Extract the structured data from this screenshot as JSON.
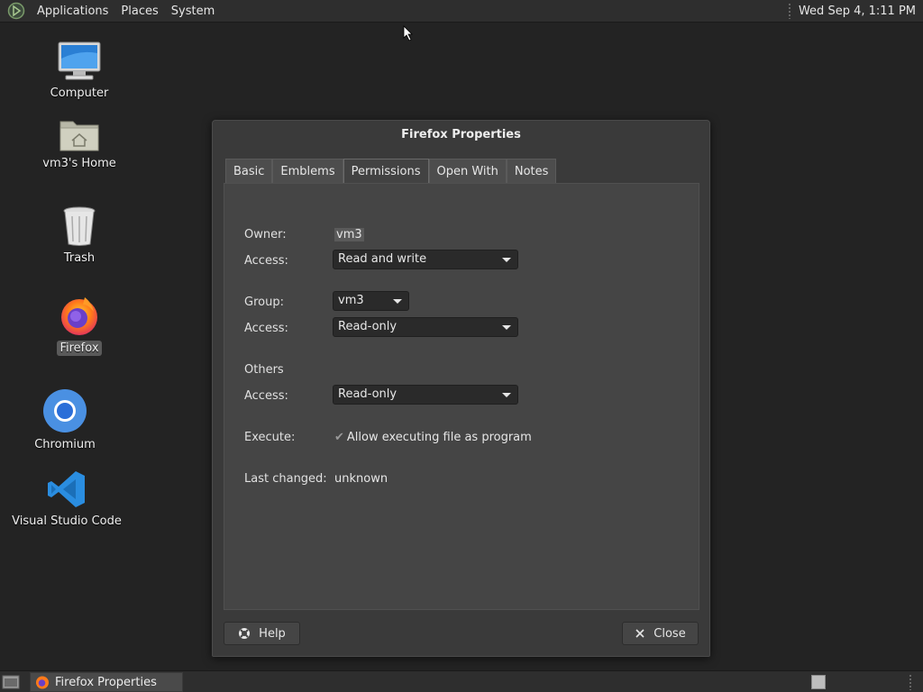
{
  "top_panel": {
    "menus": [
      "Applications",
      "Places",
      "System"
    ],
    "clock": "Wed Sep  4, 1:11 PM"
  },
  "desktop_icons": [
    {
      "label": "Computer",
      "icon": "computer-icon"
    },
    {
      "label": "vm3's Home",
      "icon": "home-folder-icon"
    },
    {
      "label": "Trash",
      "icon": "trash-icon"
    },
    {
      "label": "Firefox",
      "icon": "firefox-icon",
      "selected": true
    },
    {
      "label": "Chromium",
      "icon": "chromium-icon"
    },
    {
      "label": "Visual Studio Code",
      "icon": "vscode-icon"
    }
  ],
  "dialog": {
    "title": "Firefox Properties",
    "tabs": [
      "Basic",
      "Emblems",
      "Permissions",
      "Open With",
      "Notes"
    ],
    "active_tab": "Permissions",
    "permissions": {
      "owner_label": "Owner:",
      "owner_value": "vm3",
      "owner_access_label": "Access:",
      "owner_access": "Read and write",
      "group_label": "Group:",
      "group_value": "vm3",
      "group_access_label": "Access:",
      "group_access": "Read-only",
      "others_label": "Others",
      "others_access_label": "Access:",
      "others_access": "Read-only",
      "execute_label": "Execute:",
      "execute_checkbox_label": "Allow executing file as program",
      "execute_checked": true,
      "last_changed_label": "Last changed:",
      "last_changed_value": "unknown"
    },
    "help_button": "Help",
    "close_button": "Close"
  },
  "taskbar": {
    "window_button": "Firefox Properties"
  }
}
